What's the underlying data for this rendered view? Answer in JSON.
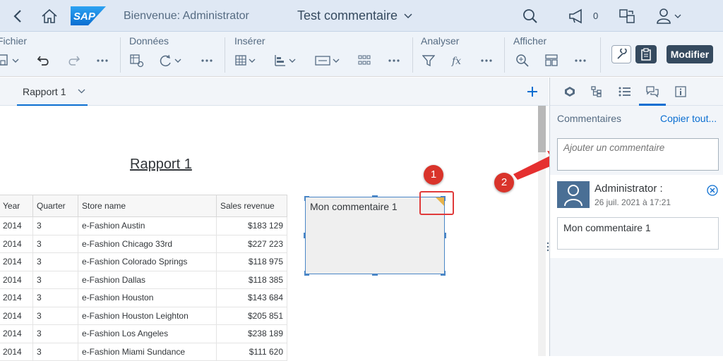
{
  "shell": {
    "logo_text": "SAP",
    "welcome": "Bienvenue: Administrator",
    "document_title": "Test commentaire",
    "notification_count": "0"
  },
  "toolbar": {
    "groups": [
      "Fichier",
      "Données",
      "Insérer",
      "Analyser",
      "Afficher"
    ],
    "modify_label": "Modifier"
  },
  "tabs": {
    "report_tab": "Rapport 1"
  },
  "report": {
    "title": "Rapport 1",
    "columns": [
      "Year",
      "Quarter",
      "Store name",
      "Sales revenue"
    ],
    "rows": [
      [
        "2014",
        "3",
        "e-Fashion Austin",
        "$183 129"
      ],
      [
        "2014",
        "3",
        "e-Fashion Chicago 33rd",
        "$227 223"
      ],
      [
        "2014",
        "3",
        "e-Fashion Colorado Springs",
        "$118 975"
      ],
      [
        "2014",
        "3",
        "e-Fashion Dallas",
        "$118 385"
      ],
      [
        "2014",
        "3",
        "e-Fashion Houston",
        "$143 684"
      ],
      [
        "2014",
        "3",
        "e-Fashion Houston Leighton",
        "$205 851"
      ],
      [
        "2014",
        "3",
        "e-Fashion Los Angeles",
        "$238 189"
      ],
      [
        "2014",
        "3",
        "e-Fashion Miami Sundance",
        "$111 620"
      ]
    ],
    "comment_box_text": "Mon commentaire 1"
  },
  "annotations": {
    "badge_1": "1",
    "badge_2": "2"
  },
  "panel": {
    "heading": "Commentaires",
    "copy_all": "Copier tout...",
    "add_placeholder": "Ajouter un commentaire",
    "comment": {
      "author": "Administrator :",
      "date": "26 juil. 2021 à 17:21",
      "text": "Mon commentaire 1"
    }
  },
  "colors": {
    "shell_bg": "#dfe8f4",
    "accent": "#0a6ed1",
    "primary_button": "#354a5f",
    "badge_red": "#d9342b",
    "comment_marker": "#e8b34a"
  }
}
